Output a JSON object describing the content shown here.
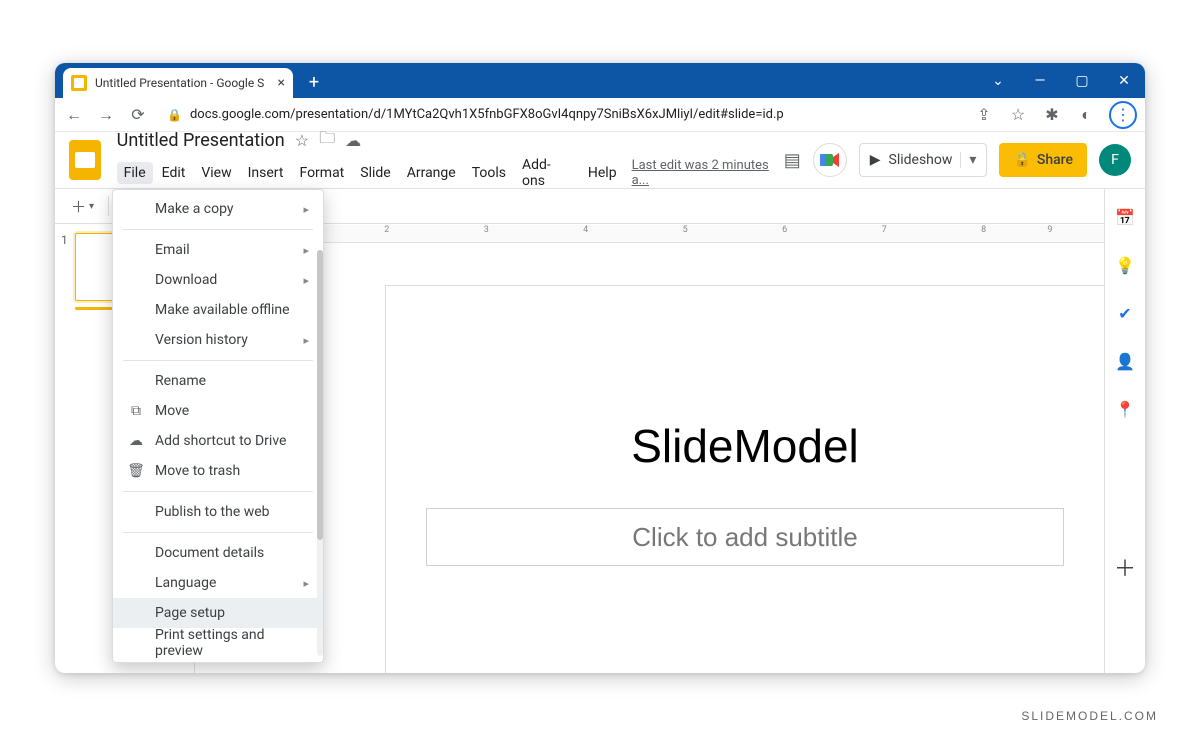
{
  "browser": {
    "tab_title": "Untitled Presentation - Google S",
    "url": "docs.google.com/presentation/d/1MYtCa2Qvh1X5fnbGFX8oGvI4qnpy7SniBsX6xJMliyI/edit#slide=id.p"
  },
  "header": {
    "doc_title": "Untitled Presentation",
    "last_edit": "Last edit was 2 minutes a...",
    "slideshow_label": "Slideshow",
    "share_label": "Share",
    "avatar_letter": "F"
  },
  "menubar": [
    "File",
    "Edit",
    "View",
    "Insert",
    "Format",
    "Slide",
    "Arrange",
    "Tools",
    "Add-ons",
    "Help"
  ],
  "file_menu": {
    "groups": [
      [
        {
          "label": "Make a copy",
          "sub": true,
          "icon": ""
        }
      ],
      [
        {
          "label": "Email",
          "sub": true,
          "icon": ""
        },
        {
          "label": "Download",
          "sub": true,
          "icon": ""
        },
        {
          "label": "Make available offline",
          "sub": false,
          "icon": ""
        },
        {
          "label": "Version history",
          "sub": true,
          "icon": ""
        }
      ],
      [
        {
          "label": "Rename",
          "sub": false,
          "icon": ""
        },
        {
          "label": "Move",
          "sub": false,
          "icon": "⧉"
        },
        {
          "label": "Add shortcut to Drive",
          "sub": false,
          "icon": "☁"
        },
        {
          "label": "Move to trash",
          "sub": false,
          "icon": "🗑"
        }
      ],
      [
        {
          "label": "Publish to the web",
          "sub": false,
          "icon": ""
        }
      ],
      [
        {
          "label": "Document details",
          "sub": false,
          "icon": ""
        },
        {
          "label": "Language",
          "sub": true,
          "icon": ""
        },
        {
          "label": "Page setup",
          "sub": false,
          "icon": "",
          "hover": true
        },
        {
          "label": "Print settings and preview",
          "sub": false,
          "icon": ""
        }
      ]
    ]
  },
  "slide": {
    "number": "1",
    "title": "SlideModel",
    "subtitle_placeholder": "Click to add subtitle"
  },
  "watermark": "SLIDEMODEL.COM"
}
